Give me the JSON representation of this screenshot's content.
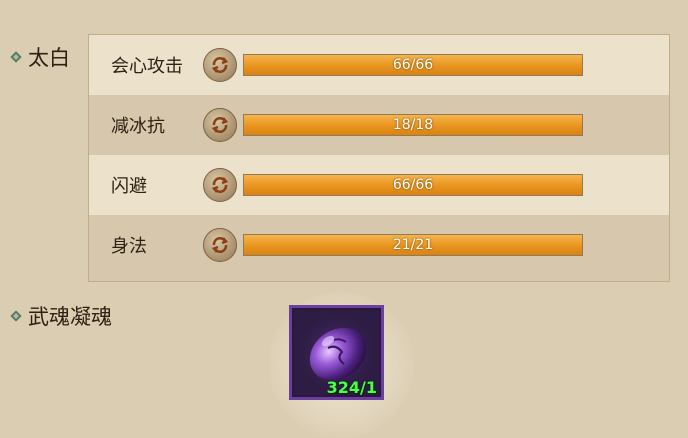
{
  "sections": {
    "first_title": "太白",
    "second_title": "武魂凝魂"
  },
  "stats": [
    {
      "label": "会心攻击",
      "value_text": "66/66",
      "current": 66,
      "max": 66
    },
    {
      "label": "减冰抗",
      "value_text": "18/18",
      "current": 18,
      "max": 18
    },
    {
      "label": "闪避",
      "value_text": "66/66",
      "current": 66,
      "max": 66
    },
    {
      "label": "身法",
      "value_text": "21/21",
      "current": 21,
      "max": 21
    }
  ],
  "item": {
    "count_text": "324/1",
    "icon": "purple-soul-stone-icon"
  },
  "colors": {
    "background": "#dbcdb1",
    "bar_fill": "#e7921c",
    "item_rarity": "#6b3fa0",
    "count_text": "#4cff4c"
  }
}
